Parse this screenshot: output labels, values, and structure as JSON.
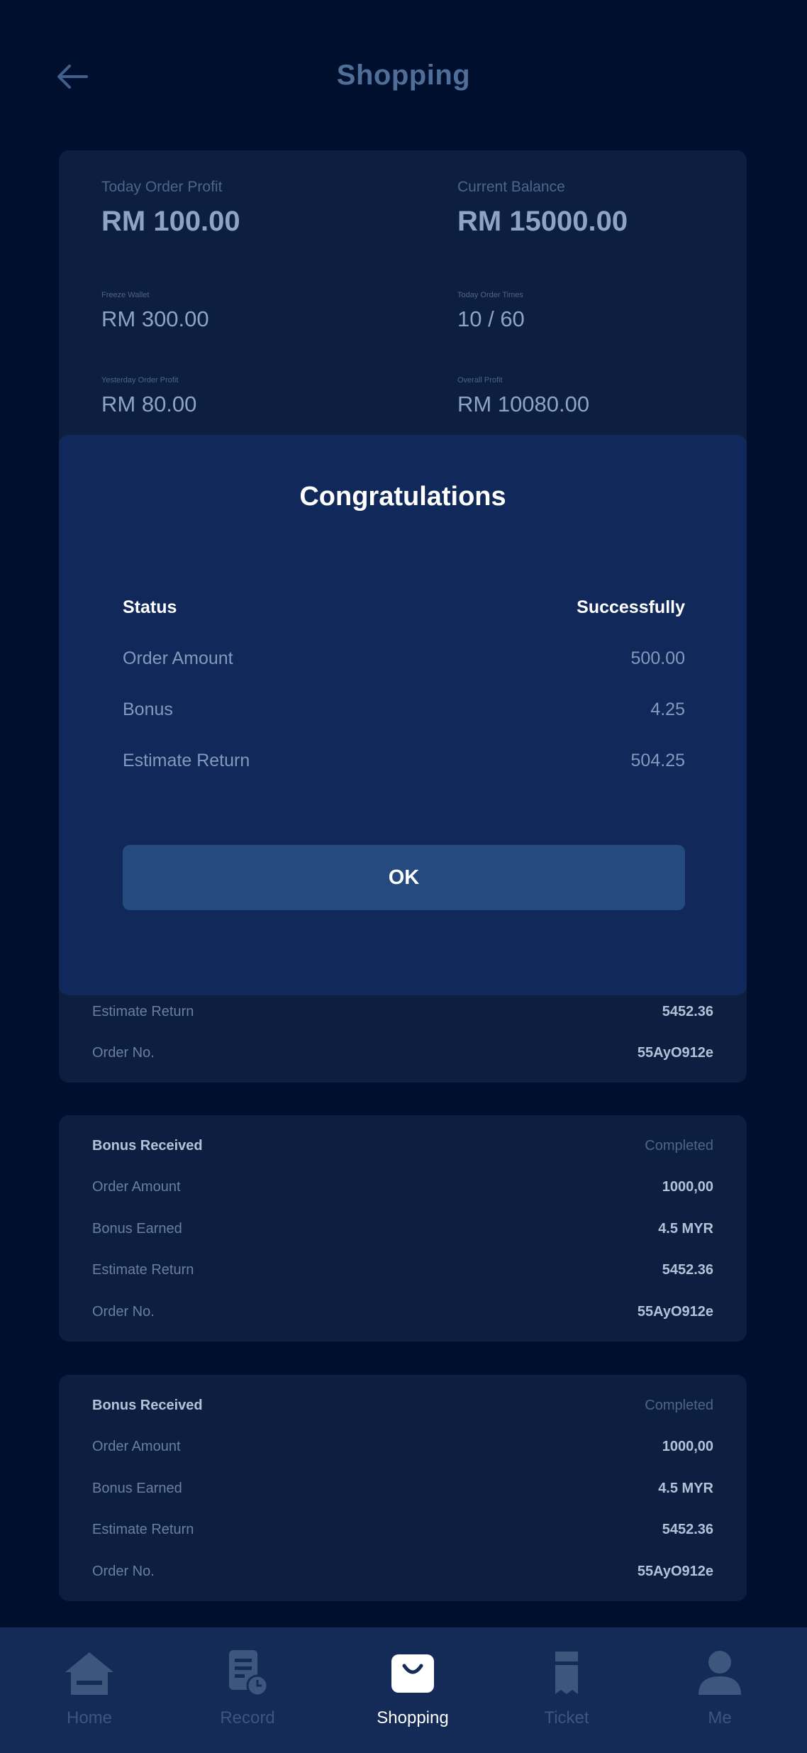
{
  "header": {
    "title": "Shopping"
  },
  "summary": {
    "today_order_profit": {
      "label": "Today Order Profit",
      "value": "RM 100.00"
    },
    "current_balance": {
      "label": "Current Balance",
      "value": "RM 15000.00"
    },
    "freeze_wallet": {
      "label": "Freeze Wallet",
      "value": "RM 300.00"
    },
    "today_order_times": {
      "label": "Today Order Times",
      "value": "10 / 60"
    },
    "yesterday_order_profit": {
      "label": "Yesterday Order Profit",
      "value": "RM 80.00"
    },
    "overall_profit": {
      "label": "Overall Profit",
      "value": "RM 10080.00"
    }
  },
  "modal": {
    "title": "Congratulations",
    "rows": [
      {
        "label": "Status",
        "value": "Successfully"
      },
      {
        "label": "Order Amount",
        "value": "500.00"
      },
      {
        "label": "Bonus",
        "value": "4.25"
      },
      {
        "label": "Estimate Return",
        "value": "504.25"
      }
    ],
    "ok_label": "OK"
  },
  "orders": [
    {
      "estimate_return_label": "Estimate Return",
      "estimate_return": "5452.36",
      "order_no_label": "Order No.",
      "order_no": "55AyO912e"
    },
    {
      "status_label": "Bonus Received",
      "status": "Completed",
      "order_amount_label": "Order Amount",
      "order_amount": "1000,00",
      "bonus_earned_label": "Bonus Earned",
      "bonus_earned": "4.5 MYR",
      "estimate_return_label": "Estimate Return",
      "estimate_return": "5452.36",
      "order_no_label": "Order No.",
      "order_no": "55AyO912e"
    },
    {
      "status_label": "Bonus Received",
      "status": "Completed",
      "order_amount_label": "Order Amount",
      "order_amount": "1000,00",
      "bonus_earned_label": "Bonus Earned",
      "bonus_earned": "4.5 MYR",
      "estimate_return_label": "Estimate Return",
      "estimate_return": "5452.36",
      "order_no_label": "Order No.",
      "order_no": "55AyO912e"
    }
  ],
  "nav": {
    "items": [
      {
        "label": "Home",
        "icon": "home-icon"
      },
      {
        "label": "Record",
        "icon": "record-icon"
      },
      {
        "label": "Shopping",
        "icon": "shopping-bag-icon"
      },
      {
        "label": "Ticket",
        "icon": "ticket-icon"
      },
      {
        "label": "Me",
        "icon": "user-icon"
      }
    ],
    "active": "Shopping"
  },
  "colors": {
    "background": "#010f2e",
    "card": "#0d1f41",
    "modal": "#11285a",
    "button": "#244a7f",
    "nav": "#142a57"
  }
}
